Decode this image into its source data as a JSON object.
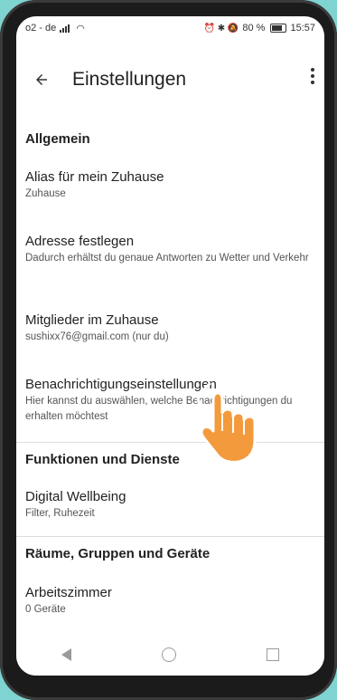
{
  "status": {
    "carrier": "o2 - de",
    "right_icons": "⏰ ✱ 🔕",
    "battery": "80 %",
    "time": "15:57"
  },
  "appbar": {
    "title": "Einstellungen"
  },
  "sections": {
    "general": "Allgemein",
    "functions": "Funktionen und Dienste",
    "rooms": "Räume, Gruppen und Geräte"
  },
  "items": {
    "alias_title": "Alias für mein Zuhause",
    "alias_sub": "Zuhause",
    "address_title": "Adresse festlegen",
    "address_sub": "Dadurch erhältst du genaue Antworten zu Wetter und Verkehr",
    "members_title": "Mitglieder im Zuhause",
    "members_sub": "sushixx76@gmail.com (nur du)",
    "notif_title": "Benachrichtigungseinstellungen",
    "notif_sub": "Hier kannst du auswählen, welche Benachrichtigungen du erhalten möchtest",
    "wellbeing_title": "Digital Wellbeing",
    "wellbeing_sub": "Filter, Ruhezeit",
    "office_title": "Arbeitszimmer",
    "office_sub": "0 Geräte"
  },
  "icons": {
    "back": "arrow-left-icon",
    "more": "more-vert-icon",
    "pointer": "pointing-hand-icon"
  },
  "colors": {
    "hand": "#f39a3c",
    "background": "#7fd3d1"
  }
}
